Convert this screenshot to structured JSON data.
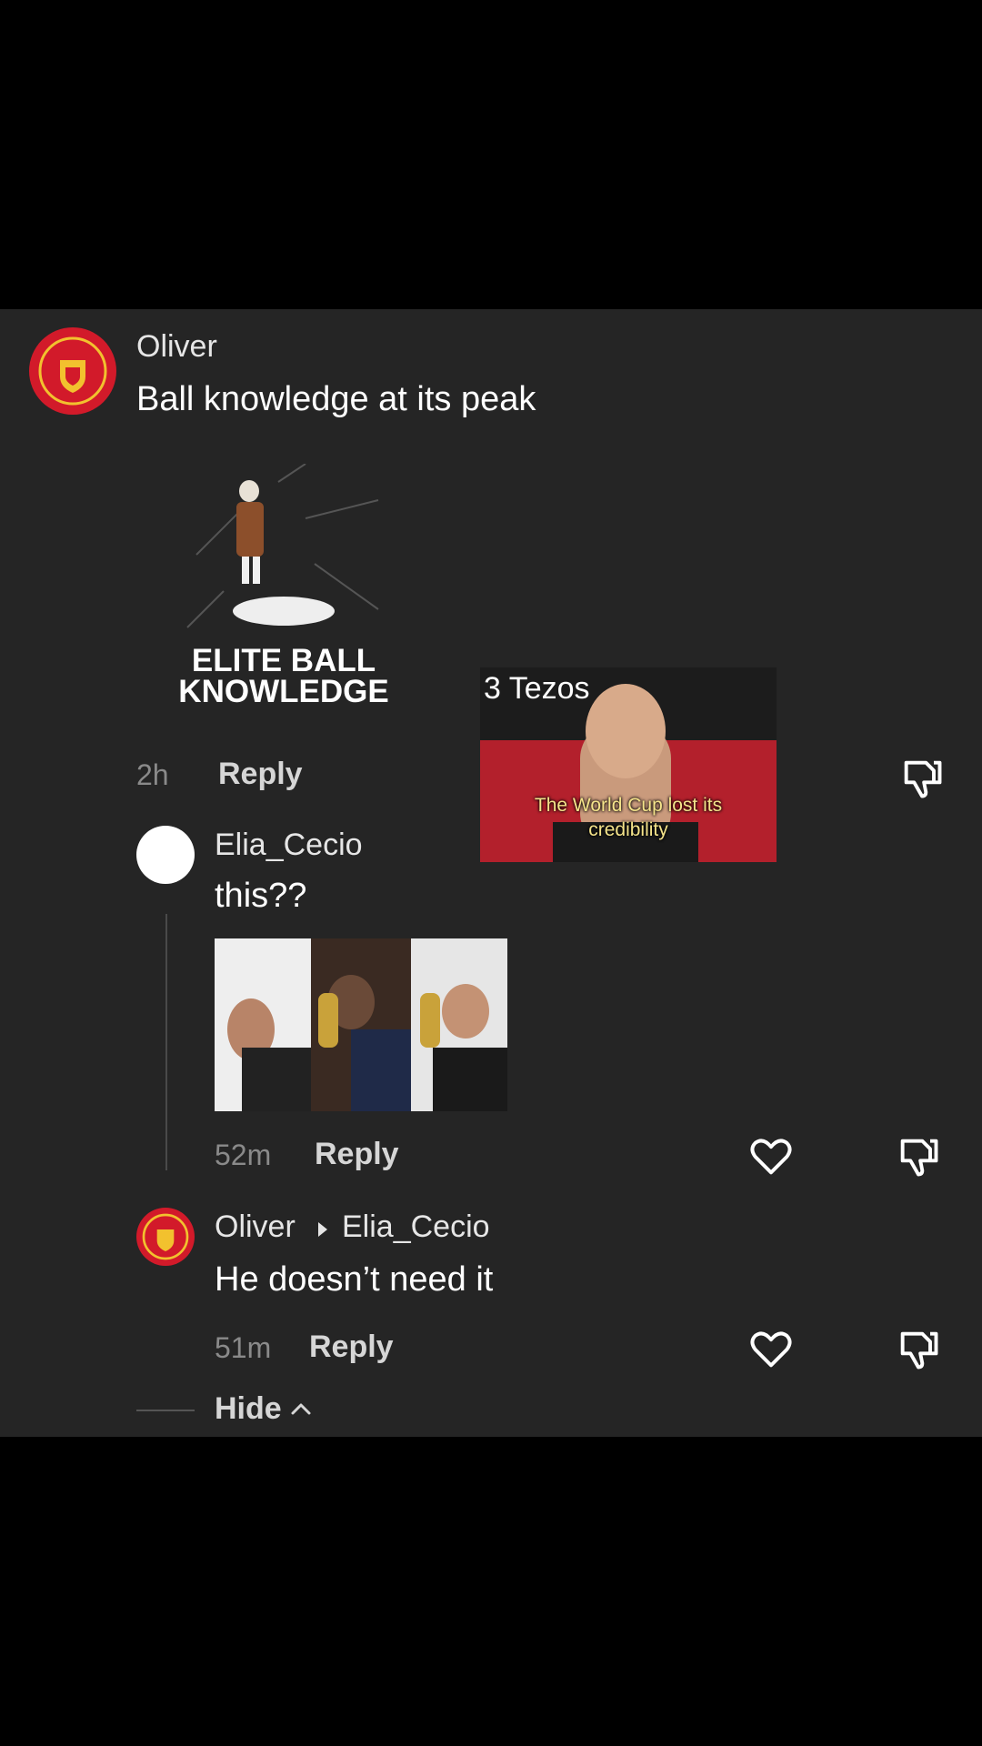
{
  "comments": {
    "top": {
      "username": "Oliver",
      "text": "Ball knowledge at its peak",
      "time": "2h",
      "reply_label": "Reply",
      "meme_text_line1": "ELITE BALL",
      "meme_text_line2": "KNOWLEDGE"
    },
    "overlay": {
      "sign_text": "3 Tezos",
      "caption_line1": "The World Cup lost its",
      "caption_line2": "credibility"
    },
    "reply1": {
      "username": "Elia_Cecio",
      "text": "this??",
      "time": "52m",
      "reply_label": "Reply"
    },
    "reply2": {
      "username": "Oliver",
      "reply_to": "Elia_Cecio",
      "text": "He doesn’t need it",
      "time": "51m",
      "reply_label": "Reply"
    },
    "hide_label": "Hide"
  },
  "colors": {
    "panel_bg": "#252525",
    "page_bg": "#000000",
    "avatar_red": "#d21a2a",
    "crest_gold": "#f2c12e"
  }
}
